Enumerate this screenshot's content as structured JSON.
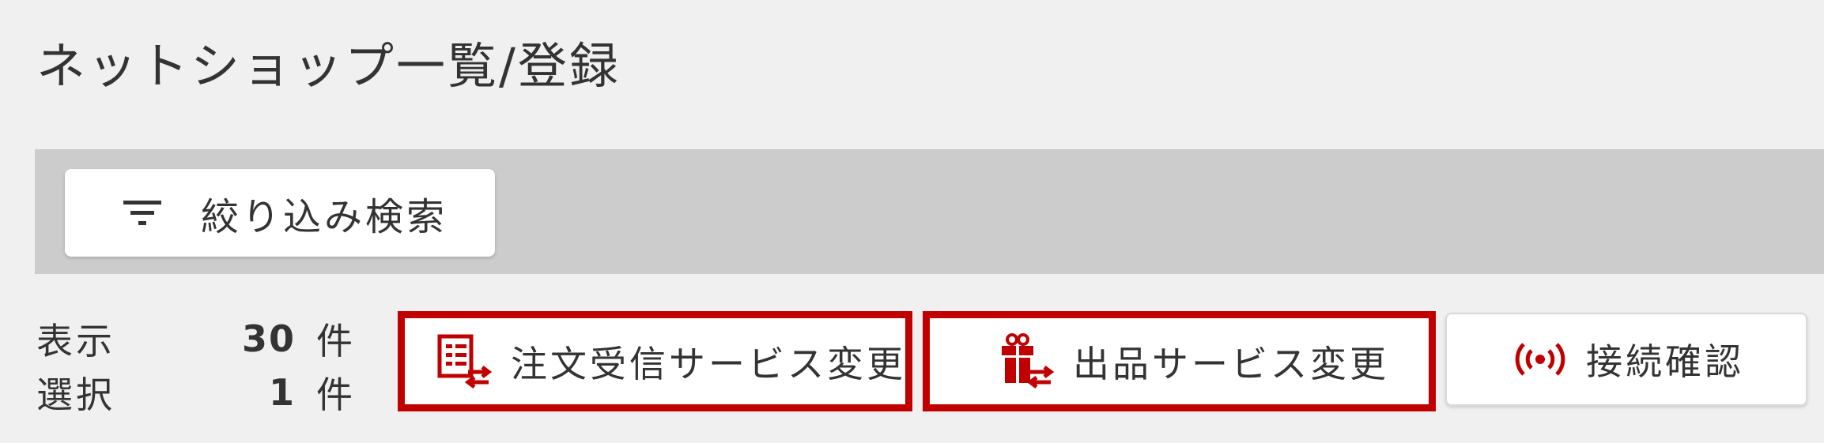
{
  "page": {
    "title": "ネットショップ一覧/登録"
  },
  "filter": {
    "button_label": "絞り込み検索",
    "icon": "filter-icon"
  },
  "counts": {
    "display_label": "表示",
    "display_value": "30",
    "selected_label": "選択",
    "selected_value": "1",
    "unit": "件"
  },
  "actions": [
    {
      "label": "注文受信サービス変更",
      "icon": "order-transfer-icon",
      "highlighted": true
    },
    {
      "label": "出品サービス変更",
      "icon": "gift-transfer-icon",
      "highlighted": true
    },
    {
      "label": "接続確認",
      "icon": "broadcast-icon",
      "highlighted": false
    }
  ],
  "colors": {
    "accent": "#c00000",
    "background": "#f0f0f0",
    "filter_bar": "#cccccc",
    "text": "#333333"
  }
}
